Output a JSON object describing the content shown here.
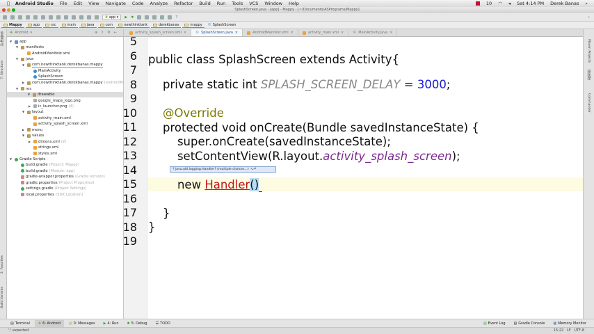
{
  "menubar": {
    "app": "Android Studio",
    "items": [
      "File",
      "Edit",
      "View",
      "Navigate",
      "Code",
      "Analyze",
      "Refactor",
      "Build",
      "Run",
      "Tools",
      "VCS",
      "Window",
      "Help"
    ],
    "clock": "Sat 4:14 PM",
    "user": "Derek Banas",
    "badge": "10"
  },
  "window": {
    "title": "SplashScreen.java - [app] - Mappy - [~/Documents/ASPrograms/Mappy]"
  },
  "toolbar": {
    "run_config": "app"
  },
  "breadcrumb": [
    "Mappy",
    "app",
    "src",
    "main",
    "java",
    "com",
    "newthinktank",
    "derekbanas",
    "mappy",
    "SplashScreen"
  ],
  "project_view": {
    "selector": "Android"
  },
  "tabs": [
    "activity_splash_screen.xml",
    "SplashScreen.java",
    "AndroidManifest.xml",
    "activity_main.xml",
    "MainActivity.java"
  ],
  "tree": [
    {
      "label": "app",
      "sub": ""
    },
    {
      "label": "manifests",
      "sub": ""
    },
    {
      "label": "AndroidManifest.xml",
      "sub": ""
    },
    {
      "label": "java",
      "sub": ""
    },
    {
      "label": "com.newthinktank.derekbanas.mappy",
      "sub": ""
    },
    {
      "label": "MainActivity",
      "sub": ""
    },
    {
      "label": "SplashScreen",
      "sub": ""
    },
    {
      "label": "com.newthinktank.derekbanas.mappy",
      "sub": "(androidTest)"
    },
    {
      "label": "res",
      "sub": ""
    },
    {
      "label": "drawable",
      "sub": ""
    },
    {
      "label": "google_maps_logo.png",
      "sub": ""
    },
    {
      "label": "ic_launcher.png",
      "sub": "(4)"
    },
    {
      "label": "layout",
      "sub": ""
    },
    {
      "label": "activity_main.xml",
      "sub": ""
    },
    {
      "label": "activity_splash_screen.xml",
      "sub": ""
    },
    {
      "label": "menu",
      "sub": ""
    },
    {
      "label": "values",
      "sub": ""
    },
    {
      "label": "dimens.xml",
      "sub": "(2)"
    },
    {
      "label": "strings.xml",
      "sub": ""
    },
    {
      "label": "styles.xml",
      "sub": ""
    },
    {
      "label": "Gradle Scripts",
      "sub": ""
    },
    {
      "label": "build.gradle",
      "sub": "(Project: Mappy)"
    },
    {
      "label": "build.gradle",
      "sub": "(Module: app)"
    },
    {
      "label": "gradle-wrapper.properties",
      "sub": "(Gradle Version)"
    },
    {
      "label": "gradle.properties",
      "sub": "(Project Properties)"
    },
    {
      "label": "settings.gradle",
      "sub": "(Project Settings)"
    },
    {
      "label": "local.properties",
      "sub": "(SDK Location)"
    }
  ],
  "editor": {
    "line_numbers": [
      "5",
      "6",
      "7",
      "8",
      "9",
      "10",
      "11",
      "12",
      "13",
      "14",
      "15",
      "16",
      "17",
      "18",
      "19"
    ],
    "l6": {
      "a": "public class SplashScreen extends Activity{"
    },
    "l8": {
      "a": "    private static int ",
      "b": "SPLASH_SCREEN_DELAY",
      "c": " = ",
      "d": "3000",
      "e": ";"
    },
    "l10": "    @Override",
    "l11": "    protected void onCreate(Bundle savedInstanceState) {",
    "l12": "        super.onCreate(savedInstanceState);",
    "l13": {
      "a": "        setContentView(R.layout.",
      "b": "activity_splash_screen",
      "c": ");"
    },
    "l15": {
      "a": "        new ",
      "b": "Handler",
      "c": "()"
    },
    "l17": "    }",
    "l18": "}",
    "hint": "? java.util.logging.Handler? (multiple choices...) ⌥⏎"
  },
  "left_strip": [
    "1: Project",
    "7: Structure",
    "2: Favorites",
    "Build Variants"
  ],
  "right_strip": [
    "Maven Projects",
    "Gradle",
    "Commander"
  ],
  "tool_windows": [
    "Terminal",
    "6: Android",
    "0: Messages",
    "4: Run",
    "5: Debug",
    "TODO"
  ],
  "tool_windows_right": [
    "Event Log",
    "Gradle Console",
    "Memory Monitor"
  ],
  "status": {
    "message": "';' expected",
    "position": "15:22",
    "line_sep": "LF",
    "encoding": "UTF-8"
  }
}
